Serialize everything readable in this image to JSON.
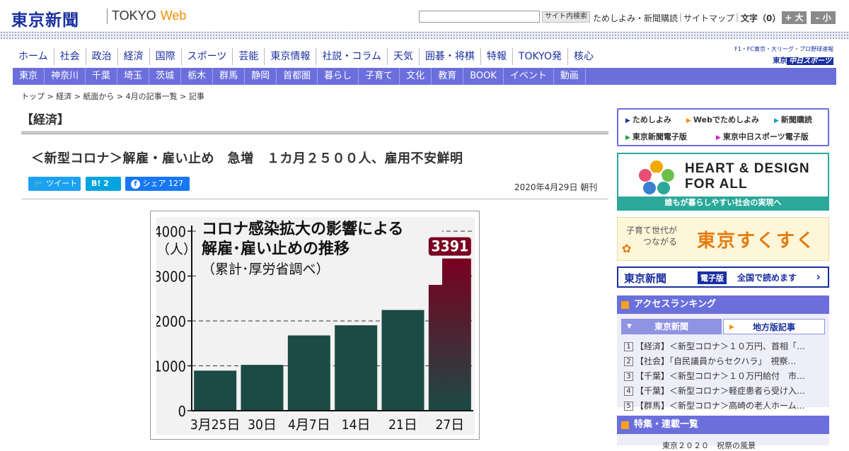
{
  "header": {
    "logo": "東京新聞",
    "logo_tokyo": "TOKYO",
    "logo_web": "Web",
    "search_button": "サイト内検索",
    "links": [
      "ためしよみ・新聞購読",
      "サイトマップ"
    ],
    "font_size_label": "文字（0）",
    "font_larger": "+ 大",
    "font_smaller": "– 小"
  },
  "main_nav": [
    "ホーム",
    "社会",
    "政治",
    "経済",
    "国際",
    "スポーツ",
    "芸能",
    "東京情報",
    "社説・コラム",
    "天気",
    "囲碁・将棋",
    "特報",
    "TOKYO発",
    "核心"
  ],
  "chunichi": {
    "top": "F1・FC東京・大リーグ・プロ野球速報",
    "brand_prefix": "東京",
    "brand": "中日スポーツ"
  },
  "sub_nav": [
    "東京",
    "神奈川",
    "千葉",
    "埼玉",
    "茨城",
    "栃木",
    "群馬",
    "静岡",
    "首都圏",
    "暮らし",
    "子育て",
    "文化",
    "教育",
    "BOOK",
    "イベント",
    "動画"
  ],
  "breadcrumb": [
    "トップ",
    "経済",
    "紙面から",
    "4月の記事一覧",
    "記事"
  ],
  "article": {
    "section": "【経済】",
    "headline": "＜新型コロナ＞解雇・雇い止め　急増　１カ月２５００人、雇用不安鮮明",
    "tweet": "ツイート",
    "hatena_b": "B!",
    "hatena_count": "2",
    "fb_label": "シェア",
    "fb_count": "127",
    "date": "2020年4月29日 朝刊"
  },
  "chart_data": {
    "type": "bar",
    "title_line1": "コロナ感染拡大の影響による",
    "title_line2": "解雇･雇い止めの推移",
    "subtitle": "（累計･厚労省調べ）",
    "ylabel": "（人）",
    "categories": [
      "3月25日",
      "30日",
      "4月7日",
      "14日",
      "21日",
      "27日"
    ],
    "values": [
      893,
      1021,
      1677,
      1903,
      2244,
      3391
    ],
    "highlight_label": "3391",
    "yticks": [
      0,
      1000,
      2000,
      3000,
      4000
    ],
    "ylim": [
      0,
      4000
    ],
    "grid": "dashed",
    "colors": {
      "bar": "#1c4a45",
      "highlight_top": "#7a0020"
    }
  },
  "sidebar": {
    "promo_links": [
      "ためしよみ",
      "Webでためしよみ",
      "新聞購読",
      "東京新聞電子版",
      "東京中日スポーツ電子版"
    ],
    "banner_hd_line1": "HEART & DESIGN",
    "banner_hd_line2": "FOR ALL",
    "banner_hd_sub": "誰もが暮らしやすい社会の実現へ",
    "sukusuku_tag_line1": "子育て世代が",
    "sukusuku_tag_line2": "つながる",
    "sukusuku_main": "東京すくすく",
    "denshi_logo": "東京新聞",
    "denshi_tag": "電子版",
    "denshi_read": "全国で読めます",
    "ranking_title": "アクセスランキング",
    "ranking_tabs": [
      "東京新聞",
      "地方版記事"
    ],
    "ranking": [
      {
        "num": "1",
        "text": "【経済】＜新型コロナ＞１０万円、首相「…"
      },
      {
        "num": "2",
        "text": "【社会】「自民議員からセクハラ」　視察…"
      },
      {
        "num": "3",
        "text": "【千葉】＜新型コロナ＞１０万円給付　市…"
      },
      {
        "num": "4",
        "text": "【千葉】＜新型コロナ＞軽症患者ら受け入…"
      },
      {
        "num": "5",
        "text": "【群馬】＜新型コロナ＞高崎の老人ホーム…"
      }
    ],
    "feature_title": "特集・連載一覧",
    "feature_partial": "東京２０２０　祝祭の風景"
  }
}
